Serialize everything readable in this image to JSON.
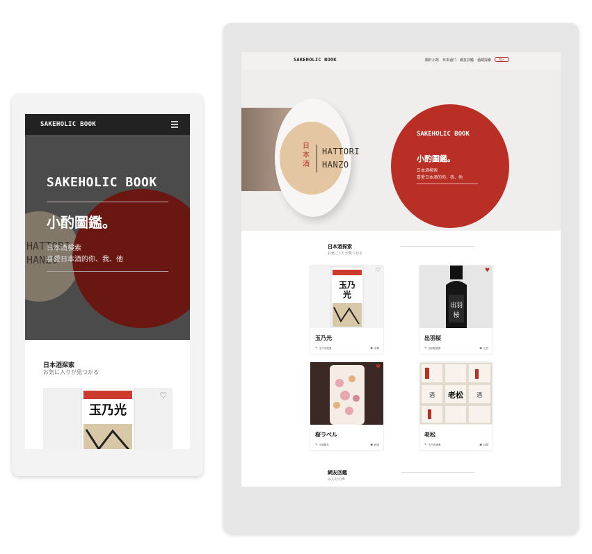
{
  "mobile": {
    "header": {
      "logo": "SAKEHOLIC BOOK",
      "menu_icon": "hamburger-icon"
    },
    "hero": {
      "cork_text": "HATTORI\nHANZO",
      "title": "SAKEHOLIC BOOK",
      "subtitle": "小酌圖鑑。",
      "desc_line1": "日本酒検索",
      "desc_line2": "喜愛日本酒的你、我、他"
    },
    "section": {
      "title": "日本酒探索",
      "subtitle": "お気に入りが見つかる"
    },
    "card": {
      "heart_icon": "heart-outline-icon"
    }
  },
  "tablet": {
    "nav": {
      "logo": "SAKEHOLIC BOOK",
      "links": [
        "關於小酌",
        "日本酒ㄇ",
        "網友評鑑",
        "酒蔵探索"
      ],
      "login": "登入"
    },
    "hero": {
      "cork_jp": "日本酒",
      "cork_en": "HATTORI\nHANZO",
      "title": "SAKEHOLIC BOOK",
      "subtitle": "小酌圖鑑。",
      "desc_line1": "日本酒検索",
      "desc_line2": "喜愛日本酒的你、我、他"
    },
    "section1": {
      "title": "日本酒探索",
      "subtitle": "お気に入りが見つかる"
    },
    "cards": [
      {
        "name": "玉乃光",
        "meta_left": "玉乃光酒造",
        "meta_right": "京都",
        "favorited": false
      },
      {
        "name": "出羽桜",
        "meta_left": "出羽桜酒造",
        "meta_right": "山形",
        "favorited": true
      },
      {
        "name": "桜ラベル",
        "meta_left": "小嶋總本",
        "meta_right": "秋田",
        "favorited": true
      },
      {
        "name": "老松",
        "meta_left": "玉乃光酒造",
        "meta_right": "兵庫",
        "favorited": false
      }
    ],
    "section2": {
      "title": "網友回鑑",
      "subtitle": "みんなの声"
    }
  },
  "colors": {
    "accent_red": "#b92f25",
    "dark_header": "#222222"
  }
}
